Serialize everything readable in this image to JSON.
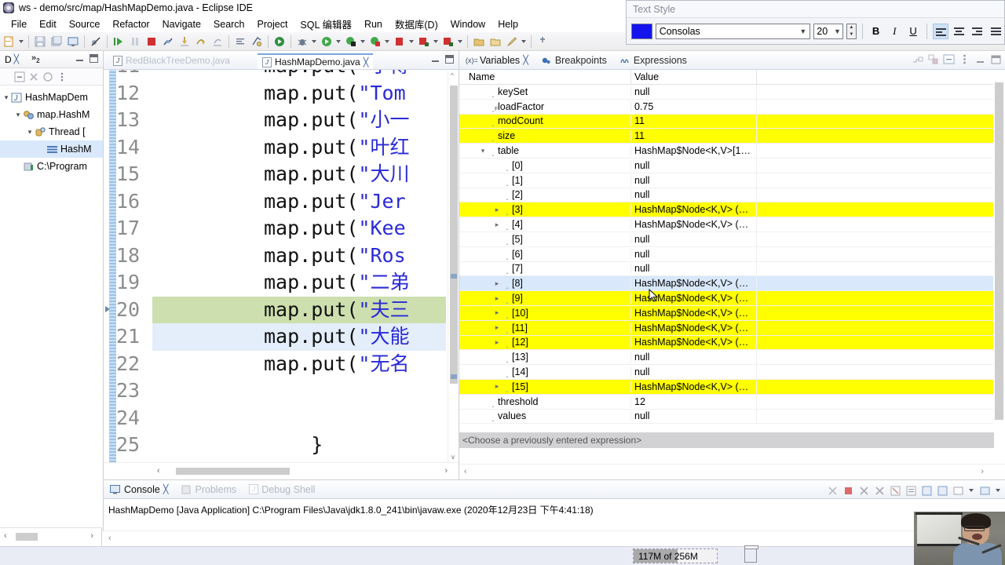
{
  "window": {
    "title": "ws - demo/src/map/HashMapDemo.java - Eclipse IDE",
    "logo_icon": "eclipse-logo-icon"
  },
  "menubar": {
    "items": [
      {
        "label": "File"
      },
      {
        "label": "Edit"
      },
      {
        "label": "Source"
      },
      {
        "label": "Refactor"
      },
      {
        "label": "Navigate"
      },
      {
        "label": "Search"
      },
      {
        "label": "Project"
      },
      {
        "label": "SQL 编辑器"
      },
      {
        "label": "Run"
      },
      {
        "label": "数据库(D)"
      },
      {
        "label": "Window"
      },
      {
        "label": "Help"
      }
    ]
  },
  "toolbar": {
    "icons": [
      "new-wizard-icon",
      "save-icon",
      "save-all-icon",
      "toggle-console-icon",
      "skip-breakpoints-icon",
      "resume-icon",
      "suspend-icon",
      "terminate-icon",
      "disconnect-icon",
      "step-into-icon",
      "step-over-icon",
      "step-return-icon",
      "next-edit-icon",
      "open-type-icon",
      "run-last-icon",
      "debug-icon",
      "coverage-icon",
      "external-tools-icon",
      "search-icon",
      "new-java-project-icon",
      "new-package-icon",
      "new-class-icon",
      "open-perspective-icon"
    ]
  },
  "text_style_dialog": {
    "title": "Text Style",
    "color_swatch": "#1414ee",
    "font_family_value": "Consolas",
    "font_size_value": "20",
    "bold_label": "B",
    "italic_label": "I",
    "underline_label": "U",
    "align_left_label": "align-left",
    "align_center_label": "align-center",
    "align_right_label": "align-right",
    "align_justify_label": "align-justify"
  },
  "debug_view": {
    "tab_label": "D",
    "chevron_label": "»",
    "chevron_count": "2",
    "toolbar_icons": [
      "collapse-all-icon",
      "remove-all-terminated-icon",
      "relaunch-icon",
      "view-menu-icon"
    ],
    "tree": [
      {
        "label": "HashMapDem",
        "indent": 0,
        "caret": "v",
        "icon": "java-launch-icon",
        "selected": false
      },
      {
        "label": "map.HashM",
        "indent": 1,
        "caret": "v",
        "icon": "debug-target-icon",
        "selected": false
      },
      {
        "label": "Thread [",
        "indent": 2,
        "caret": "v",
        "icon": "thread-icon",
        "selected": false
      },
      {
        "label": "HashM",
        "indent": 3,
        "caret": "",
        "icon": "stack-frame-icon",
        "selected": true
      },
      {
        "label": "C:\\Program",
        "indent": 1,
        "caret": "",
        "icon": "jre-icon",
        "selected": false
      }
    ]
  },
  "editor": {
    "tabs": [
      {
        "label": "RedBlackTreeDemo.java",
        "active": false,
        "closable": false,
        "icon": "java-file-icon"
      },
      {
        "label": "HashMapDemo.java",
        "active": true,
        "closable": true,
        "icon": "java-file-icon"
      }
    ],
    "minimize_icon": "minimize-icon",
    "maximize_icon": "maximize-icon",
    "font_name": "Consolas",
    "font_size": "20",
    "lines": [
      {
        "no": "11",
        "code": "map.put(\"子博",
        "state": "normal",
        "partial_top": true
      },
      {
        "no": "12",
        "code": "map.put(\"Tom",
        "state": "normal"
      },
      {
        "no": "13",
        "code": "map.put(\"小一",
        "state": "normal"
      },
      {
        "no": "14",
        "code": "map.put(\"叶红",
        "state": "normal"
      },
      {
        "no": "15",
        "code": "map.put(\"大川",
        "state": "normal"
      },
      {
        "no": "16",
        "code": "map.put(\"Jer",
        "state": "normal"
      },
      {
        "no": "17",
        "code": "map.put(\"Kee",
        "state": "normal"
      },
      {
        "no": "18",
        "code": "map.put(\"Ros",
        "state": "normal"
      },
      {
        "no": "19",
        "code": "map.put(\"二弟",
        "state": "normal"
      },
      {
        "no": "20",
        "code": "map.put(\"夫三",
        "state": "current"
      },
      {
        "no": "21",
        "code": "map.put(\"大能",
        "state": "selected"
      },
      {
        "no": "22",
        "code": "map.put(\"无名",
        "state": "normal"
      },
      {
        "no": "23",
        "code": "",
        "state": "normal"
      },
      {
        "no": "24",
        "code": "",
        "state": "normal"
      },
      {
        "no": "25",
        "code": "    }",
        "state": "normal"
      }
    ]
  },
  "variables_view": {
    "tabs": [
      {
        "label": "Variables",
        "active": true,
        "closable": true,
        "icon": "variables-icon"
      },
      {
        "label": "Breakpoints",
        "active": false,
        "closable": false,
        "icon": "breakpoints-icon"
      },
      {
        "label": "Expressions",
        "active": false,
        "closable": false,
        "icon": "expressions-icon"
      }
    ],
    "toolbar_icons": [
      "show-logical-structure-icon",
      "collapse-all-icon",
      "view-menu-icon",
      "minimize-icon",
      "maximize-icon"
    ],
    "columns": [
      "Name",
      "Value"
    ],
    "rows": [
      {
        "name": "keySet",
        "value": "null",
        "indent": 1,
        "expander": "",
        "final": false,
        "highlight": "none"
      },
      {
        "name": "loadFactor",
        "value": "0.75",
        "indent": 1,
        "expander": "",
        "final": true,
        "highlight": "none"
      },
      {
        "name": "modCount",
        "value": "11",
        "indent": 1,
        "expander": "",
        "final": false,
        "highlight": "yellow"
      },
      {
        "name": "size",
        "value": "11",
        "indent": 1,
        "expander": "",
        "final": false,
        "highlight": "yellow"
      },
      {
        "name": "table",
        "value": "HashMap$Node<K,V>[1…",
        "indent": 1,
        "expander": "v",
        "final": false,
        "highlight": "none"
      },
      {
        "name": "[0]",
        "value": "null",
        "indent": 2,
        "expander": "",
        "final": false,
        "highlight": "none"
      },
      {
        "name": "[1]",
        "value": "null",
        "indent": 2,
        "expander": "",
        "final": false,
        "highlight": "none"
      },
      {
        "name": "[2]",
        "value": "null",
        "indent": 2,
        "expander": "",
        "final": false,
        "highlight": "none"
      },
      {
        "name": "[3]",
        "value": "HashMap$Node<K,V>  (…",
        "indent": 2,
        "expander": ">",
        "final": false,
        "highlight": "yellow"
      },
      {
        "name": "[4]",
        "value": "HashMap$Node<K,V>  (…",
        "indent": 2,
        "expander": ">",
        "final": false,
        "highlight": "none"
      },
      {
        "name": "[5]",
        "value": "null",
        "indent": 2,
        "expander": "",
        "final": false,
        "highlight": "none"
      },
      {
        "name": "[6]",
        "value": "null",
        "indent": 2,
        "expander": "",
        "final": false,
        "highlight": "none"
      },
      {
        "name": "[7]",
        "value": "null",
        "indent": 2,
        "expander": "",
        "final": false,
        "highlight": "none"
      },
      {
        "name": "[8]",
        "value": "HashMap$Node<K,V>  (…",
        "indent": 2,
        "expander": ">",
        "final": false,
        "highlight": "blue"
      },
      {
        "name": "[9]",
        "value": "HashMap$Node<K,V>  (…",
        "indent": 2,
        "expander": ">",
        "final": false,
        "highlight": "yellow"
      },
      {
        "name": "[10]",
        "value": "HashMap$Node<K,V>  (…",
        "indent": 2,
        "expander": ">",
        "final": false,
        "highlight": "yellow"
      },
      {
        "name": "[11]",
        "value": "HashMap$Node<K,V>  (…",
        "indent": 2,
        "expander": ">",
        "final": false,
        "highlight": "yellow"
      },
      {
        "name": "[12]",
        "value": "HashMap$Node<K,V>  (…",
        "indent": 2,
        "expander": ">",
        "final": false,
        "highlight": "yellow"
      },
      {
        "name": "[13]",
        "value": "null",
        "indent": 2,
        "expander": "",
        "final": false,
        "highlight": "none"
      },
      {
        "name": "[14]",
        "value": "null",
        "indent": 2,
        "expander": "",
        "final": false,
        "highlight": "none"
      },
      {
        "name": "[15]",
        "value": "HashMap$Node<K,V>  (…",
        "indent": 2,
        "expander": ">",
        "final": false,
        "highlight": "yellow"
      },
      {
        "name": "threshold",
        "value": "12",
        "indent": 1,
        "expander": "",
        "final": false,
        "highlight": "none"
      },
      {
        "name": "values",
        "value": "null",
        "indent": 1,
        "expander": "",
        "final": false,
        "highlight": "none"
      }
    ],
    "expression_placeholder": "<Choose a previously entered expression>"
  },
  "console_view": {
    "tabs": [
      {
        "label": "Console",
        "active": true,
        "closable": true,
        "icon": "console-icon"
      },
      {
        "label": "Problems",
        "active": false,
        "closable": false,
        "icon": "problems-icon"
      },
      {
        "label": "Debug Shell",
        "active": false,
        "closable": false,
        "icon": "debug-shell-icon"
      }
    ],
    "toolbar_icons": [
      "terminate-icon",
      "remove-launch-icon",
      "remove-all-icon",
      "clear-console-icon",
      "scroll-lock-icon",
      "word-wrap-icon",
      "pin-console-icon",
      "display-console-icon",
      "open-console-icon"
    ],
    "output_line": "HashMapDemo [Java Application] C:\\Program Files\\Java\\jdk1.8.0_241\\bin\\javaw.exe (2020年12月23日 下午4:41:18)"
  },
  "status_bar": {
    "memory_used": "117M",
    "memory_of": " of 256M",
    "trash_icon": "trash-icon"
  },
  "webcam_overlay": {
    "name": "webcam-video-overlay"
  },
  "cursor": {
    "name": "mouse-pointer"
  }
}
